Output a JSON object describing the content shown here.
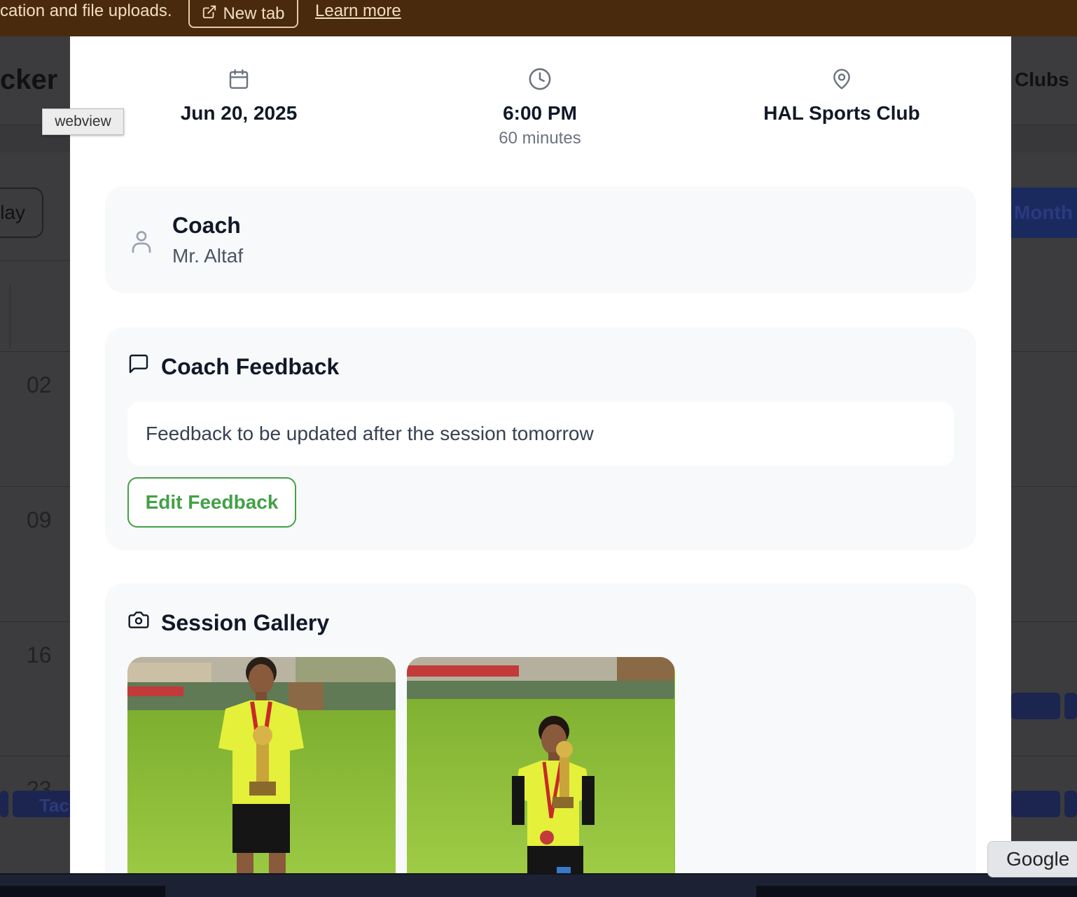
{
  "banner": {
    "message": "cation and file uploads.",
    "new_tab_label": "New tab",
    "learn_more_label": "Learn more",
    "icon": "external-link-icon"
  },
  "background": {
    "app_title": "cker",
    "clubs_label": "Clubs",
    "day_button": "lay",
    "month_button": "Month",
    "dates": [
      "02",
      "09",
      "16",
      "23"
    ],
    "chip_text": "Tac"
  },
  "tooltip": {
    "text": "webview"
  },
  "session": {
    "date": "Jun 20, 2025",
    "time": "6:00 PM",
    "duration": "60 minutes",
    "location": "HAL Sports Club",
    "coach_label": "Coach",
    "coach_name": "Mr. Altaf",
    "feedback_heading": "Coach Feedback",
    "feedback_text": "Feedback to be updated after the session tomorrow",
    "edit_feedback_label": "Edit Feedback",
    "gallery_heading": "Session Gallery",
    "photos": [
      {
        "description": "boy-with-trophy-standing"
      },
      {
        "description": "boy-with-trophy-kneeling"
      }
    ]
  },
  "google_chip": {
    "label": "Google"
  },
  "colors": {
    "accent_green": "#43a047",
    "banner_bg": "#4a2a0c",
    "card_bg": "#f8f9fb"
  }
}
